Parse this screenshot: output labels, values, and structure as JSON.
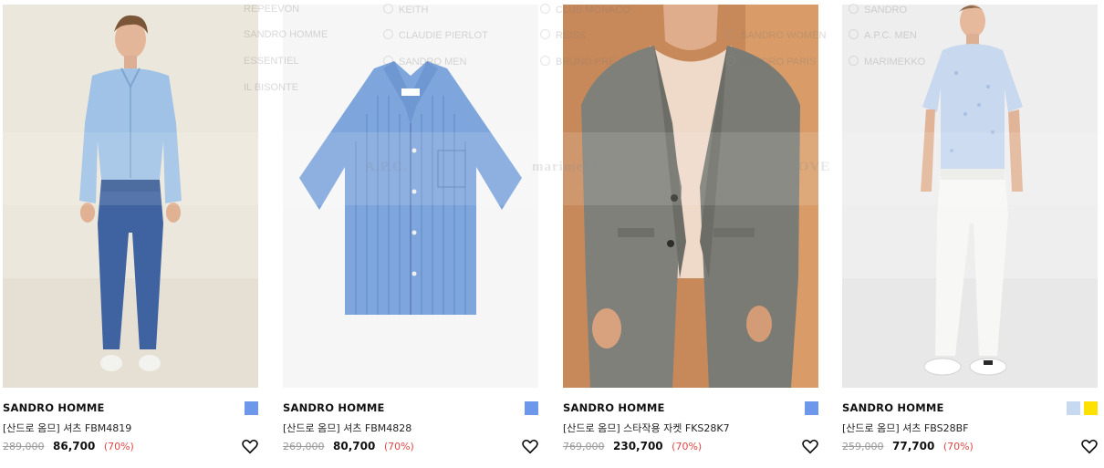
{
  "products": [
    {
      "brand": "SANDRO HOMME",
      "name": "[산드로 옴므] 셔츠 FBM4819",
      "original_price": "289,000",
      "sale_price": "86,700",
      "discount": "(70%)",
      "swatches": [
        "#6c97ea"
      ],
      "wishlist_icon": "heart-outline-icon"
    },
    {
      "brand": "SANDRO HOMME",
      "name": "[산드로 옴므] 셔츠 FBM4828",
      "original_price": "269,000",
      "sale_price": "80,700",
      "discount": "(70%)",
      "swatches": [
        "#6c97ea"
      ],
      "wishlist_icon": "heart-outline-icon"
    },
    {
      "brand": "SANDRO HOMME",
      "name": "[산드로 옴므] 스타작용 자켓 FKS28K7",
      "original_price": "769,000",
      "sale_price": "230,700",
      "discount": "(70%)",
      "swatches": [
        "#6c97ea"
      ],
      "wishlist_icon": "heart-outline-icon"
    },
    {
      "brand": "SANDRO HOMME",
      "name": "[산드로 옴므] 셔츠 FBS28BF",
      "original_price": "259,000",
      "sale_price": "77,700",
      "discount": "(70%)",
      "swatches": [
        "#c6d9f1",
        "#ffe100"
      ],
      "wishlist_icon": "heart-outline-icon"
    }
  ],
  "overlay_menu": {
    "col1": [
      "REPEEVON",
      "SANDRO HOMME",
      "ESSENTIEL",
      "IL BISONTE"
    ],
    "col2": [
      "KEITH",
      "CLAUDIE PIERLOT",
      "SANDRO MEN"
    ],
    "col3": [
      "CLUB MONACO",
      "REISS",
      "BRUNO PRE"
    ],
    "col4": [
      "SANDRO WOMEN",
      "SANDRO PARIS"
    ],
    "col5": [
      "SANDRO",
      "A.P.C. MEN",
      "MARIMEKKO"
    ],
    "logos": [
      "A.P.C.",
      "marimekko",
      "ECCOVE"
    ]
  },
  "colors": {
    "discount": "#e04747",
    "strike": "#999999",
    "accent_swatch": "#6c97ea"
  }
}
